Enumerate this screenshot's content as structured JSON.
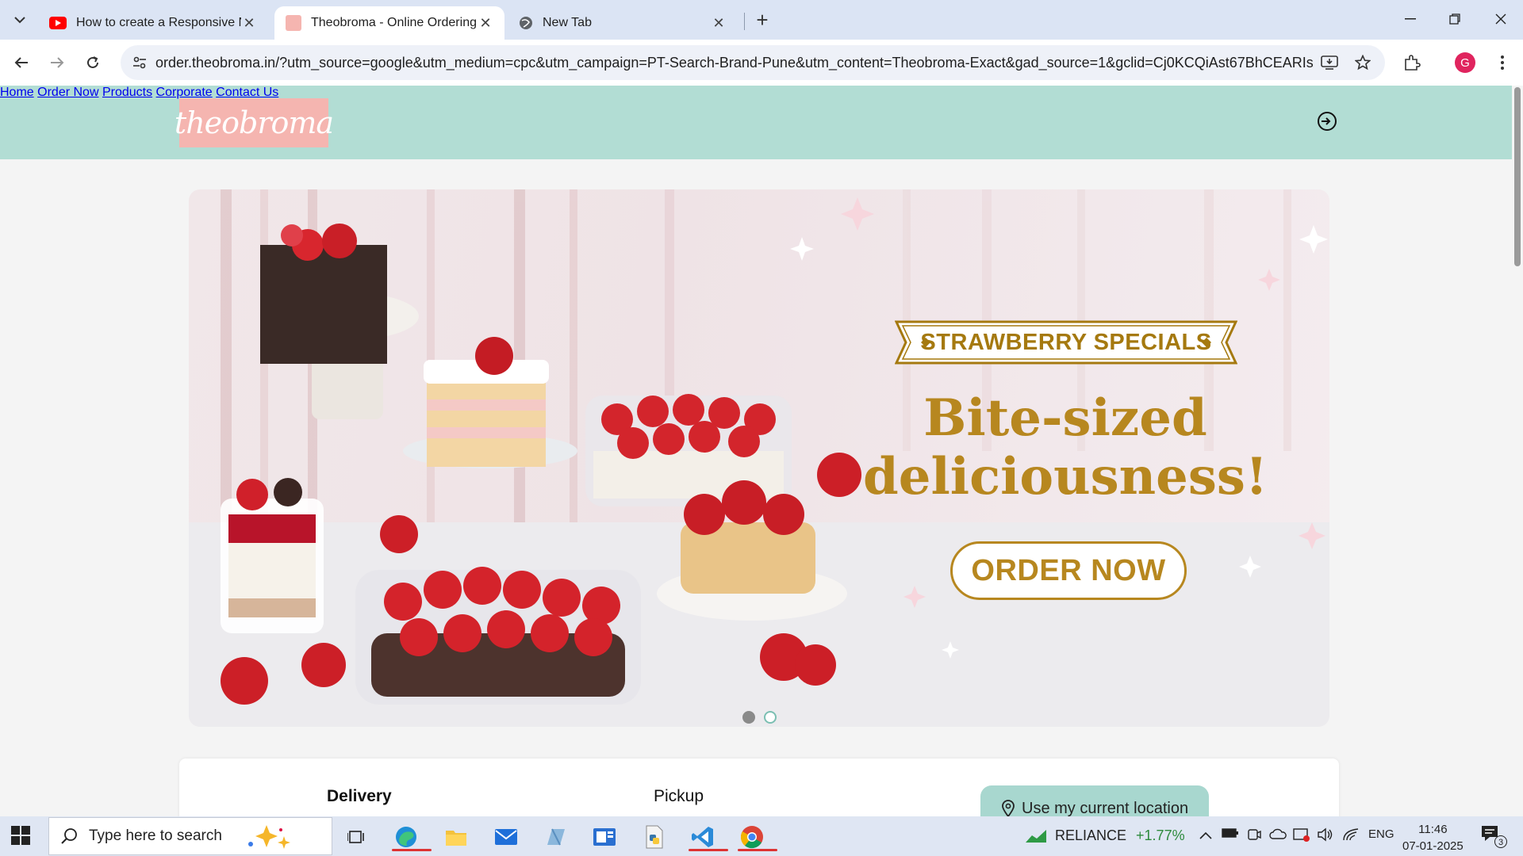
{
  "browser": {
    "tabs": [
      {
        "title": "How to create a Responsive Na",
        "favicon": "youtube-icon",
        "active": false
      },
      {
        "title": "Theobroma - Online Ordering",
        "favicon": "theobroma-favicon",
        "active": true
      },
      {
        "title": "New Tab",
        "favicon": "globe-icon",
        "active": false
      }
    ],
    "url": "order.theobroma.in/?utm_source=google&utm_medium=cpc&utm_campaign=PT-Search-Brand-Pune&utm_content=Theobroma-Exact&gad_source=1&gclid=Cj0KCQiAst67BhCEARIsAK...",
    "profile_initial": "G"
  },
  "site": {
    "logo_text": "theobroma",
    "nav": [
      "Home",
      "Order Now",
      "Products",
      "Corporate",
      "Contact Us"
    ]
  },
  "banner": {
    "ribbon": "STRAWBERRY SPECIALS",
    "headline_line1": "Bite-sized",
    "headline_line2": "deliciousness!",
    "cta": "ORDER NOW",
    "slides": 2,
    "active_slide": 1
  },
  "order_card": {
    "tabs": [
      "Delivery",
      "Pickup"
    ],
    "location_button": "Use my current location"
  },
  "taskbar": {
    "search_placeholder": "Type here to search",
    "stock_name": "RELIANCE",
    "stock_change": "+1.77%",
    "language": "ENG",
    "time": "11:46",
    "date": "07-01-2025",
    "notification_count": "3"
  },
  "colors": {
    "header_bg": "#b2ddd4",
    "gold": "#b7871f",
    "logo_bg": "#f5b5b0",
    "location_button": "#a8d7cf"
  }
}
